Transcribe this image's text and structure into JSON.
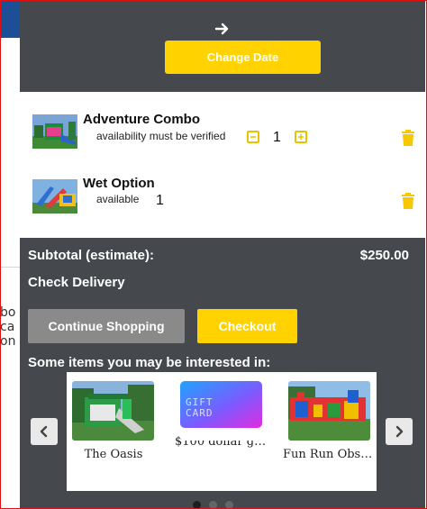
{
  "background_page": {
    "text_fragments": [
      "bo",
      "ca",
      "on"
    ]
  },
  "header": {
    "arrow_icon": "arrow-right-icon",
    "change_date_label": "Change Date"
  },
  "cart": {
    "items": [
      {
        "name": "Adventure Combo",
        "status": "availability must be verified",
        "quantity": "1",
        "has_stepper": true
      },
      {
        "name": "Wet Option",
        "status": "available",
        "quantity": "1",
        "has_stepper": false
      }
    ],
    "subtotal_label": "Subtotal (estimate):",
    "subtotal_value": "$250.00",
    "check_delivery_label": "Check Delivery",
    "continue_label": "Continue Shopping",
    "checkout_label": "Checkout"
  },
  "recommendations": {
    "title": "Some items you may be interested in:",
    "items": [
      {
        "label": "The Oasis"
      },
      {
        "label": "$100 dollar gif…",
        "card_text_1": "GIFT",
        "card_text_2": "CARD"
      },
      {
        "label": "Fun Run Obst…"
      }
    ]
  },
  "colors": {
    "panel_bg": "#45494d",
    "accent_yellow": "#ffd200",
    "continue_gray": "#8a8a8a"
  }
}
